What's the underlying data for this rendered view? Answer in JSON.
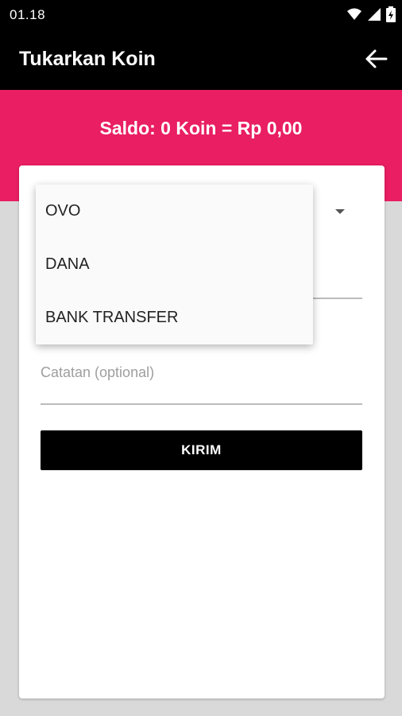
{
  "status_bar": {
    "time": "01.18"
  },
  "app_bar": {
    "title": "Tukarkan Koin"
  },
  "banner": {
    "saldo": "Saldo: 0 Koin = Rp 0,00"
  },
  "form": {
    "notes_placeholder": "Catatan (optional)",
    "submit_label": "KIRIM"
  },
  "dropdown": {
    "options": [
      "OVO",
      "DANA",
      "BANK TRANSFER"
    ]
  },
  "colors": {
    "accent": "#e91e63",
    "bar": "#000000",
    "background": "#d9d9d9"
  }
}
